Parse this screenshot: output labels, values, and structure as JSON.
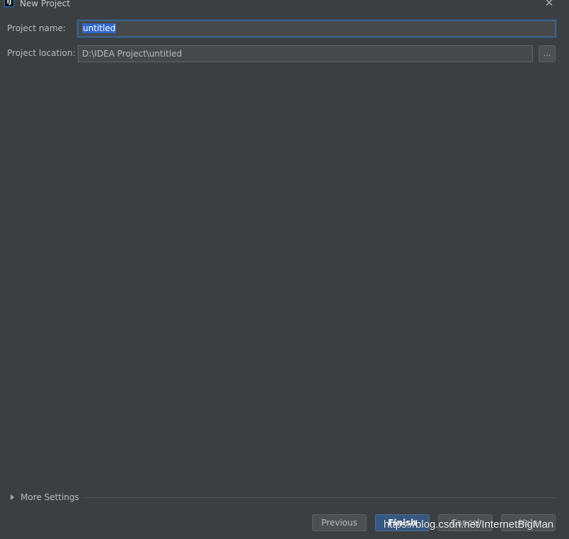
{
  "window": {
    "title": "New Project",
    "close_symbol": "✕",
    "app_icon": "intellij-idea-icon",
    "app_icon_glyph": "IJ"
  },
  "form": {
    "project_name_label": "Project name:",
    "project_name_value": "untitled",
    "project_location_label": "Project location:",
    "project_location_value": "D:\\IDEA Project\\untitled",
    "browse_label": "..."
  },
  "more_settings": {
    "label": "More Settings",
    "icon": "triangle-right-icon"
  },
  "buttons": {
    "previous": "Previous",
    "finish": "Finish",
    "cancel": "Cancel",
    "help": "Help"
  },
  "watermark": "https://blog.csdn.net/InternetBigMan",
  "colors": {
    "background": "#3c3f41",
    "field_background": "#45494a",
    "selection": "#2f65ca",
    "primary_button": "#365880"
  }
}
